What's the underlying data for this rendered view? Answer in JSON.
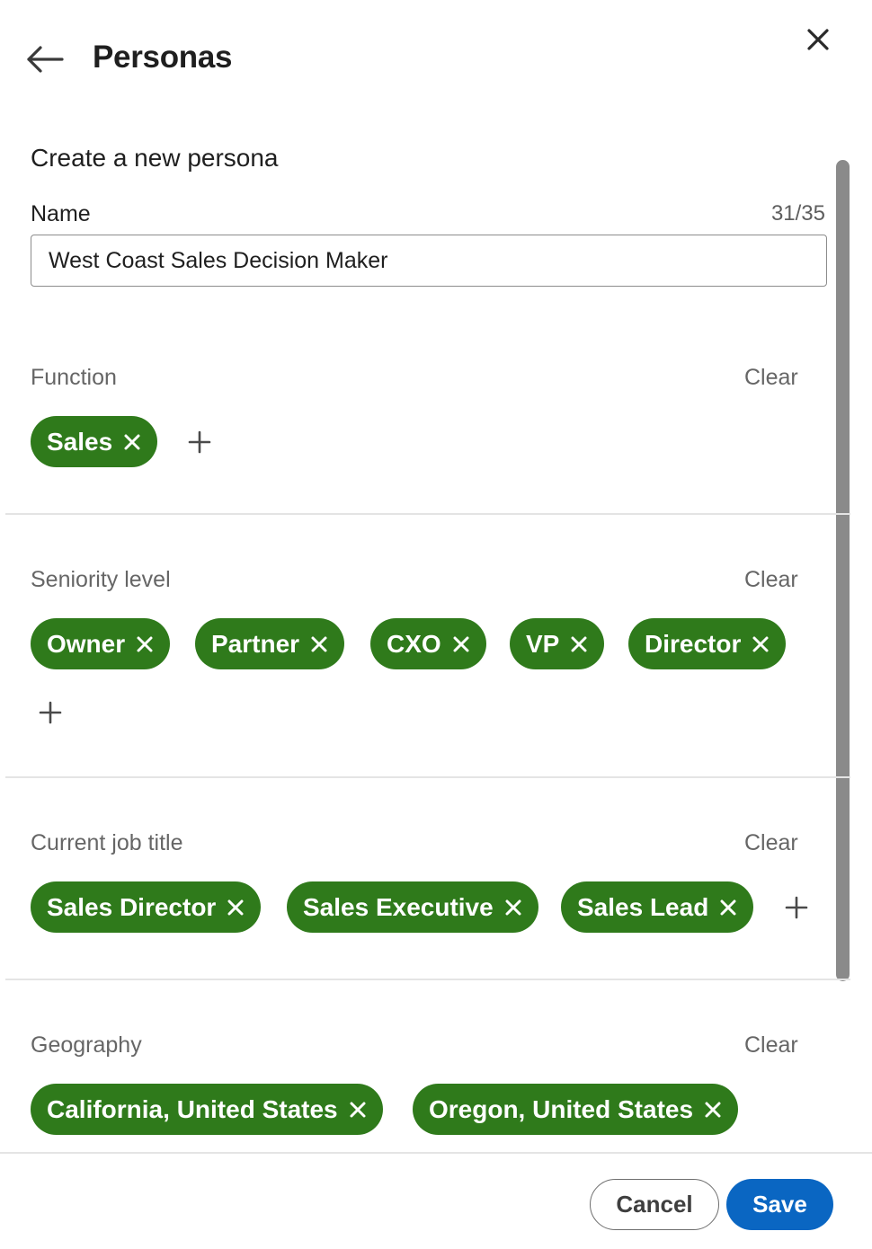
{
  "header": {
    "title": "Personas",
    "back_icon": "arrow-left-icon",
    "close_icon": "close-icon"
  },
  "form": {
    "subtitle": "Create a new persona",
    "name_label": "Name",
    "name_count": "31/35",
    "name_value": "West Coast Sales Decision Maker"
  },
  "sections": {
    "function": {
      "label": "Function",
      "clear": "Clear",
      "chips": [
        "Sales"
      ]
    },
    "seniority": {
      "label": "Seniority level",
      "clear": "Clear",
      "chips": [
        "Owner",
        "Partner",
        "CXO",
        "VP",
        "Director"
      ]
    },
    "job_title": {
      "label": "Current job title",
      "clear": "Clear",
      "chips": [
        "Sales Director",
        "Sales Executive",
        "Sales Lead"
      ]
    },
    "geography": {
      "label": "Geography",
      "clear": "Clear",
      "chips": [
        "California, United States",
        "Oregon, United States"
      ]
    }
  },
  "footer": {
    "cancel_label": "Cancel",
    "save_label": "Save"
  },
  "colors": {
    "chip_green": "#2f7a1b",
    "primary_blue": "#0a66c2"
  }
}
